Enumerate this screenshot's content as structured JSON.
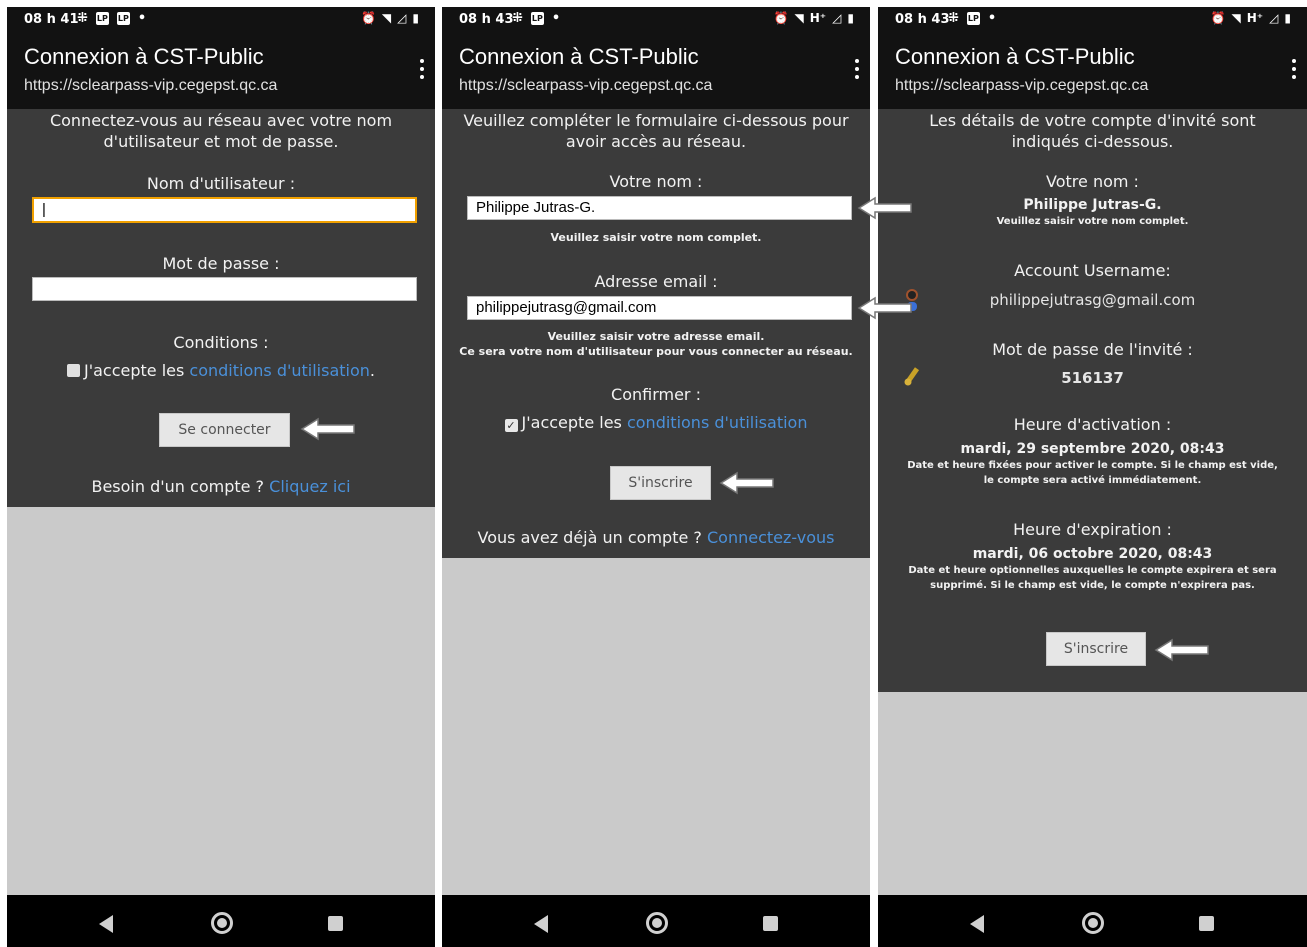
{
  "panel1": {
    "status": {
      "time": "08 h 41"
    },
    "title": "Connexion à CST-Public",
    "url": "https://sclearpass-vip.cegepst.qc.ca",
    "intro": [
      "Connectez-vous au réseau avec votre nom",
      "d'utilisateur et mot de passe."
    ],
    "username_label": "Nom d'utilisateur :",
    "username_value": "|",
    "password_label": "Mot de passe :",
    "conditions_label": "Conditions :",
    "accept_prefix": "J'accepte les ",
    "accept_link": "conditions d'utilisation",
    "accept_suffix": ".",
    "connect_button": "Se connecter",
    "need_account": "Besoin d'un compte ? ",
    "click_here": "Cliquez ici"
  },
  "panel2": {
    "status": {
      "time": "08 h 43",
      "net": "H⁺"
    },
    "title": "Connexion à CST-Public",
    "url": "https://sclearpass-vip.cegepst.qc.ca",
    "intro": [
      "Veuillez compléter le formulaire ci-dessous pour",
      "avoir accès au réseau."
    ],
    "name_label": "Votre nom :",
    "name_value": "Philippe Jutras-G.",
    "name_hint": "Veuillez saisir votre nom complet.",
    "email_label": "Adresse email :",
    "email_value": "philippejutrasg@gmail.com",
    "email_hint_1": "Veuillez saisir votre adresse email.",
    "email_hint_2": "Ce sera votre nom d'utilisateur pour vous connecter au réseau.",
    "confirm_label": "Confirmer :",
    "checkmark": "✓",
    "accept_prefix": "J'accepte les ",
    "accept_link": "conditions d'utilisation",
    "register_button": "S'inscrire",
    "have_account": "Vous avez déjà un compte ? ",
    "connect_link": "Connectez-vous"
  },
  "panel3": {
    "status": {
      "time": "08 h 43",
      "net": "H⁺"
    },
    "title": "Connexion à CST-Public",
    "url": "https://sclearpass-vip.cegepst.qc.ca",
    "intro": [
      "Les détails de votre compte d'invité sont",
      "indiqués ci-dessous."
    ],
    "name_label": "Votre nom :",
    "name_value": "Philippe Jutras-G.",
    "name_hint": "Veuillez saisir votre nom complet.",
    "account_label": "Account Username:",
    "account_value": "philippejutrasg@gmail.com",
    "password_label": "Mot de passe de l'invité :",
    "password_value": "516137",
    "activation_label": "Heure d'activation :",
    "activation_value": "mardi, 29 septembre 2020, 08:43",
    "activation_hint_1": "Date et heure fixées pour activer le compte. Si le champ est vide,",
    "activation_hint_2": "le compte sera activé immédiatement.",
    "expiration_label": "Heure d'expiration :",
    "expiration_value": "mardi, 06 octobre 2020, 08:43",
    "expiration_hint_1": "Date et heure optionnelles auxquelles le compte expirera et sera",
    "expiration_hint_2": "supprimé. Si le champ est vide, le compte n'expirera pas.",
    "register_button": "S'inscrire"
  },
  "icons": [
    "sim-icon",
    "lp-icon",
    "alarm-icon",
    "wifi-off-icon",
    "signal-icon",
    "battery-icon",
    "menu-dots-icon",
    "arrow-left-icon",
    "user-icon",
    "key-icon",
    "back-icon",
    "home-icon",
    "recents-icon"
  ],
  "colors": {
    "bar": "#121212",
    "content": "#3b3b3b",
    "page": "#cacaca",
    "link": "#4a90d9",
    "field_focus": "#f0a000"
  }
}
